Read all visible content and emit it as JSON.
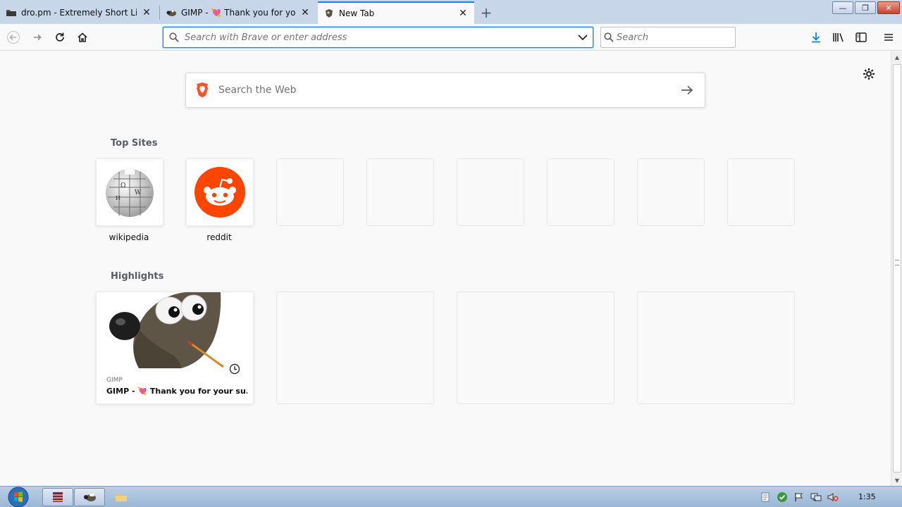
{
  "tabs": [
    {
      "title": "dro.pm - Extremely Short Links",
      "icon": "folder-icon"
    },
    {
      "title": "GIMP - 💘 Thank you for your",
      "icon": "gimp-icon"
    },
    {
      "title": "New Tab",
      "icon": "brave-icon"
    }
  ],
  "window_controls": {
    "minimize": "—",
    "maximize": "❐",
    "close": "✕"
  },
  "navbar": {
    "url_placeholder": "Search with Brave or enter address",
    "search_placeholder": "Search"
  },
  "newtab": {
    "websearch_placeholder": "Search the Web",
    "top_sites_title": "Top Sites",
    "top_sites": [
      {
        "label": "wikipedia"
      },
      {
        "label": "reddit"
      }
    ],
    "highlights_title": "Highlights",
    "highlight": {
      "source": "GIMP",
      "title": "GIMP - 💘 Thank you for your su..."
    }
  },
  "taskbar": {
    "clock": "1:35"
  },
  "colors": {
    "accent": "#0a84ff",
    "reddit": "#ff4500",
    "brave": "#fb542b"
  }
}
